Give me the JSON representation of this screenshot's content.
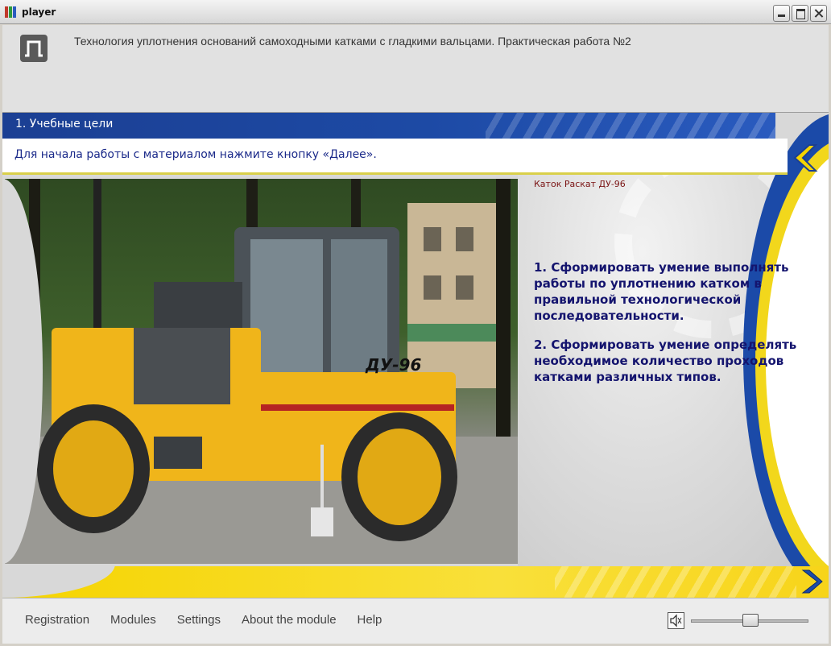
{
  "window": {
    "title": "player",
    "icon": "app-bars-icon",
    "controls": [
      "minimize-icon",
      "maximize-icon",
      "close-icon"
    ]
  },
  "header": {
    "logo": "logo-icon",
    "course_title": "Технология уплотнения оснований самоходными катками с гладкими вальцами. Практическая работа №2"
  },
  "section": {
    "title": "1. Учебные цели",
    "instruction": "Для начала работы с материалом нажмите кнопку «Далее».",
    "back_icon": "chevron-left-icon",
    "next_icon": "chevron-right-icon"
  },
  "photo": {
    "caption": "Каток Раскат ДУ-96",
    "machine_label": "ДУ-96"
  },
  "goals": [
    "1. Сформировать умение выполнять работы по уплотнению катком в правильной технологической последовательности.",
    "2. Сформировать умение определять необходимое количество проходов катками различных типов."
  ],
  "footer": {
    "menu": [
      "Registration",
      "Modules",
      "Settings",
      "About the module",
      "Help"
    ],
    "volume_icon": "speaker-icon",
    "volume_level": 0.5
  },
  "colors": {
    "accent_blue": "#1b4aa8",
    "accent_yellow": "#f5d400",
    "goal_text": "#14146e",
    "caption_text": "#7a1414"
  }
}
